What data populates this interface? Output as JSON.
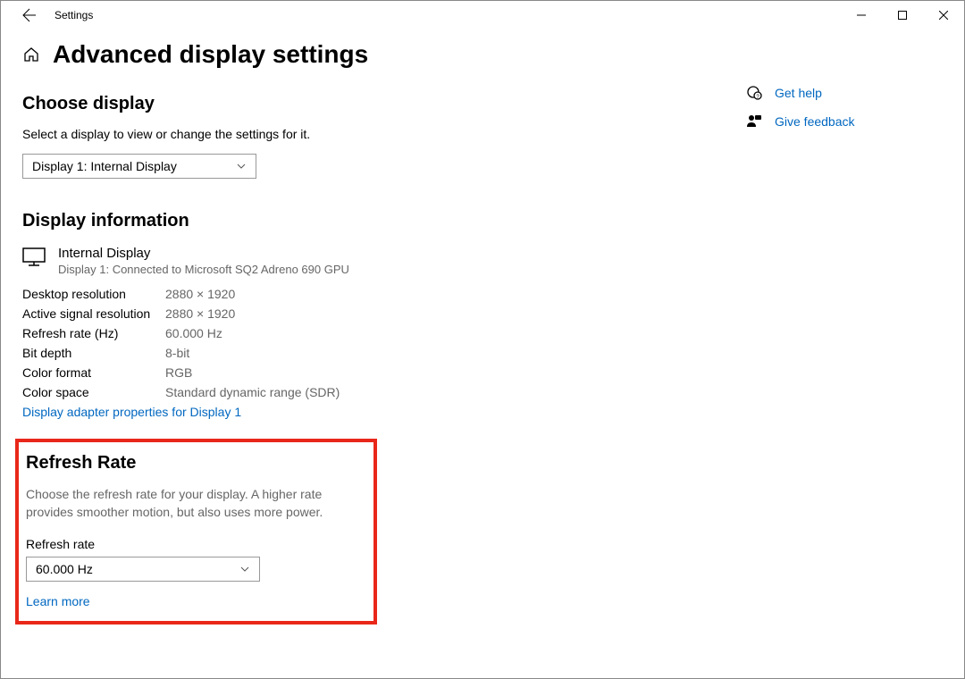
{
  "window": {
    "title": "Settings"
  },
  "page_title": "Advanced display settings",
  "choose_display": {
    "heading": "Choose display",
    "desc": "Select a display to view or change the settings for it.",
    "selected": "Display 1: Internal Display"
  },
  "display_info": {
    "heading": "Display information",
    "name": "Internal Display",
    "subtitle": "Display 1: Connected to Microsoft SQ2 Adreno 690 GPU",
    "rows": [
      {
        "label": "Desktop resolution",
        "value": "2880 × 1920"
      },
      {
        "label": "Active signal resolution",
        "value": "2880 × 1920"
      },
      {
        "label": "Refresh rate (Hz)",
        "value": "60.000 Hz"
      },
      {
        "label": "Bit depth",
        "value": "8-bit"
      },
      {
        "label": "Color format",
        "value": "RGB"
      },
      {
        "label": "Color space",
        "value": "Standard dynamic range (SDR)"
      }
    ],
    "adapter_link": "Display adapter properties for Display 1"
  },
  "refresh_rate": {
    "heading": "Refresh Rate",
    "desc": "Choose the refresh rate for your display. A higher rate provides smoother motion, but also uses more power.",
    "label": "Refresh rate",
    "selected": "60.000 Hz",
    "learn_more": "Learn more"
  },
  "side": {
    "help": "Get help",
    "feedback": "Give feedback"
  }
}
